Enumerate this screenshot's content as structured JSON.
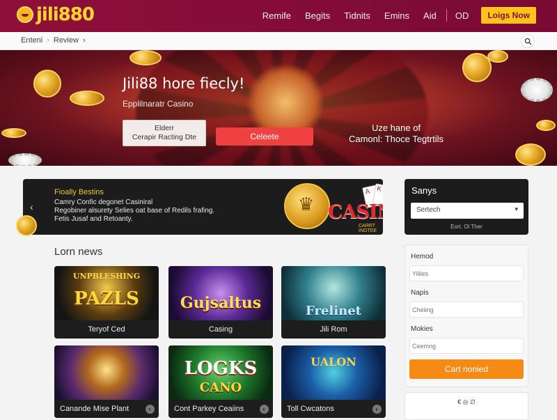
{
  "header": {
    "logo_text": "jili880",
    "nav": [
      "Remife",
      "Begits",
      "Tidnits",
      "Emins",
      "Aid",
      "OD"
    ],
    "cta": "Loigs Now"
  },
  "breadcrumb": {
    "items": [
      "Enteni",
      "Review"
    ],
    "sep": "›",
    "trail": "›"
  },
  "hero": {
    "title": "Jili88 hore fiecly!",
    "subtitle": "Epplilnaratr Casino",
    "outline_button": [
      "Elderr",
      "Cerapir Racting Dte"
    ],
    "red_button": "Celeete",
    "right_text": [
      "Uze hane of",
      "Camonl: Thoce Tegtrtils"
    ]
  },
  "promo": {
    "arrow": "‹",
    "title": "Fioally Bestins",
    "lines": [
      "Camry Confic degonet Casiniral",
      "Regobiner alsurety Selies oat base of Redils frafing.",
      "Fetis Jusaf and Retoanty."
    ],
    "brand": "CASINO",
    "brand_sub": "CARRT INOTEE",
    "card_ranks": [
      "A",
      "K"
    ]
  },
  "news": {
    "title": "Lorn news",
    "tiles": [
      {
        "art": "PAZLS",
        "art_top": "UNPBLESHING",
        "caption": "Teryof Ced",
        "info": ""
      },
      {
        "art": "Gujsaltus",
        "art_top": "",
        "caption": "Casing",
        "info": ""
      },
      {
        "art": "Frelinet",
        "art_top": "",
        "caption": "Jili Rom",
        "info": ""
      },
      {
        "art": "",
        "art_top": "",
        "caption": "Canande Mise Plant",
        "info": "◐"
      },
      {
        "art": "LOGKS",
        "art_top": "CANO",
        "caption": "Cont Parkey Ceaiins",
        "info": "◐"
      },
      {
        "art": "",
        "art_top": "UALON",
        "caption": "Toll Cwcatons",
        "info": "◐"
      }
    ]
  },
  "sidebar": {
    "dark_card": {
      "title": "Sanys",
      "select_value": "Sertech",
      "link": "Eort. Ol Ther"
    },
    "form": {
      "fields": [
        {
          "label": "Hemod",
          "placeholder": "Yiliies"
        },
        {
          "label": "Napis",
          "placeholder": "Cheiing"
        },
        {
          "label": "Mokies",
          "placeholder": "Ceemng"
        }
      ],
      "button": "Cart nonied"
    },
    "bottom_icons": "€ ◎ ∅"
  }
}
